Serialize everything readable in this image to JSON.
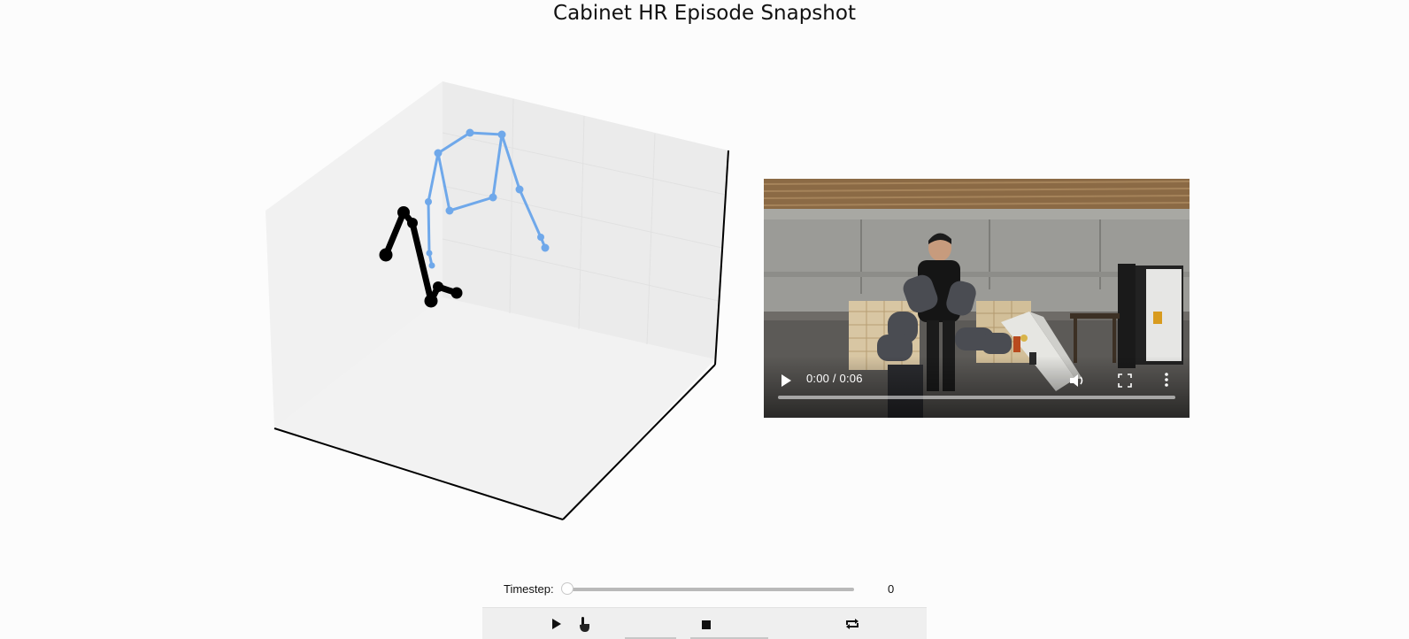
{
  "title": "Cabinet HR Episode Snapshot",
  "colors": {
    "background": "#fcfcfc",
    "human_skeleton": "#6fa8ea",
    "robot_skeleton": "#000000",
    "pane": "#ececec",
    "axis_line": "#000000"
  },
  "plot3d": {
    "type": "3d-skeleton",
    "grid": true,
    "legend": "none",
    "series": [
      {
        "color": "#6fa8ea"
      },
      {
        "color": "#000000"
      }
    ]
  },
  "video": {
    "time_display": "0:00 / 0:06",
    "progress": 0,
    "icons": {
      "play": "play-icon",
      "volume": "volume-icon",
      "fullscreen": "fullscreen-icon",
      "more": "more-options-icon"
    }
  },
  "slider": {
    "label": "Timestep:",
    "value": "0",
    "position_fraction": 0
  },
  "controls": {
    "icons": [
      "play-icon",
      "pause-icon",
      "stop-icon",
      "repeat-icon"
    ]
  }
}
